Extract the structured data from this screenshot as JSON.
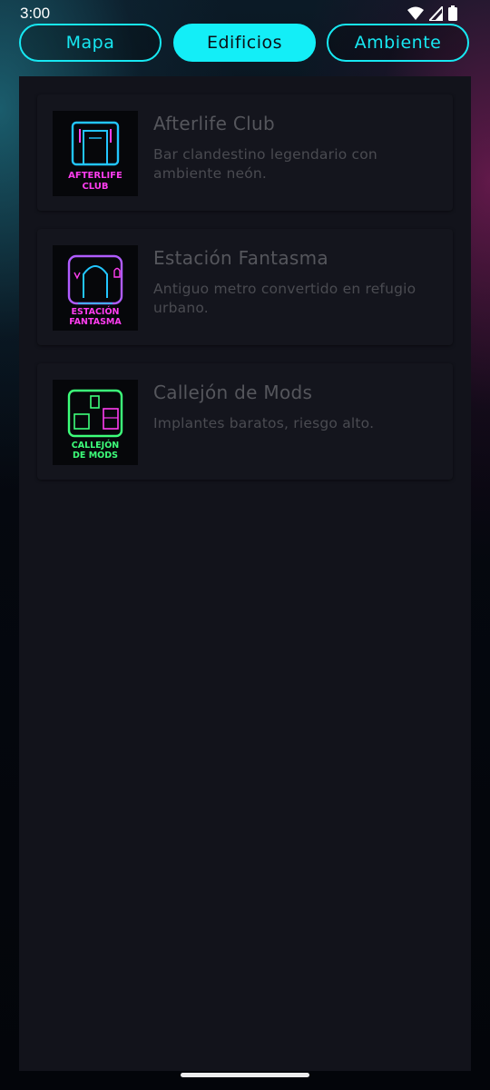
{
  "status_bar": {
    "time": "3:00"
  },
  "tabs": [
    {
      "label": "Mapa",
      "active": false
    },
    {
      "label": "Edificios",
      "active": true
    },
    {
      "label": "Ambiente",
      "active": false
    }
  ],
  "buildings": [
    {
      "title": "Afterlife Club",
      "description": "Bar clandestino legendario con ambiente neón.",
      "thumb_lines": [
        "AFTERLIFE",
        "CLUB"
      ],
      "accent": "#ff3df0",
      "frame": "#22c6ff"
    },
    {
      "title": "Estación Fantasma",
      "description": "Antiguo metro convertido en refugio urbano.",
      "thumb_lines": [
        "ESTACIÓN",
        "FANTASMA"
      ],
      "accent": "#ff3df0",
      "frame": "#b05cff"
    },
    {
      "title": "Callejón de Mods",
      "description": "Implantes baratos, riesgo alto.",
      "thumb_lines": [
        "CALLEJÓN",
        "DE MODS"
      ],
      "accent": "#3dff7a",
      "frame": "#3dff7a"
    }
  ],
  "colors": {
    "accent_cyan": "#13eef7",
    "panel": "#12131b",
    "card": "#14151d"
  }
}
